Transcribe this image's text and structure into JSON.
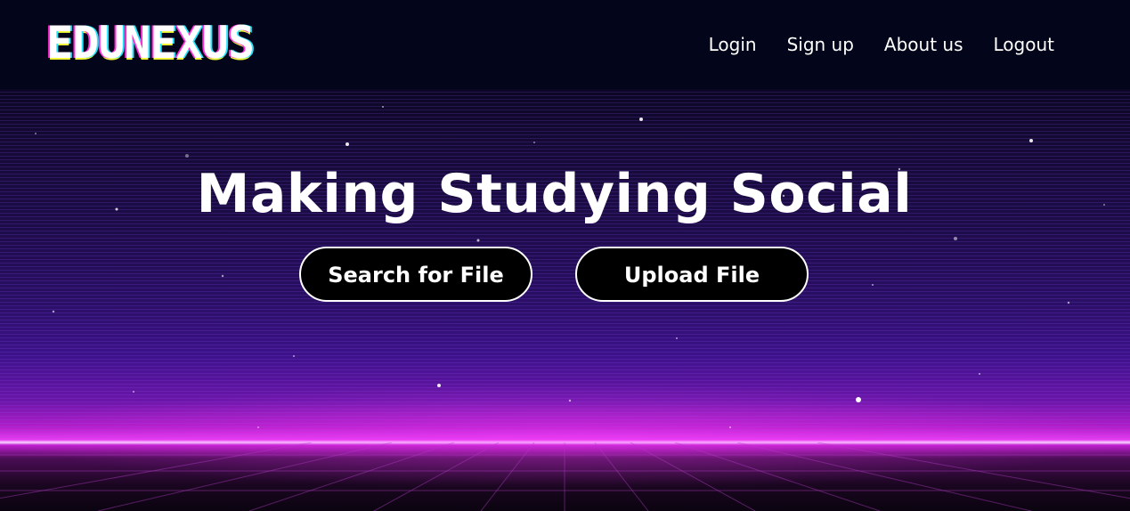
{
  "brand": {
    "logo_text": "EDUNEXUS"
  },
  "nav": {
    "items": [
      {
        "label": "Login"
      },
      {
        "label": "Sign up"
      },
      {
        "label": "About us"
      },
      {
        "label": "Logout"
      }
    ]
  },
  "hero": {
    "title": "Making Studying Social",
    "buttons": {
      "search_label": "Search for File",
      "upload_label": "Upload File"
    }
  },
  "colors": {
    "navbar_bg": "#03051a",
    "horizon_glow": "#e63cf0",
    "button_bg": "#000000",
    "button_border": "#ffffff",
    "text": "#ffffff"
  }
}
